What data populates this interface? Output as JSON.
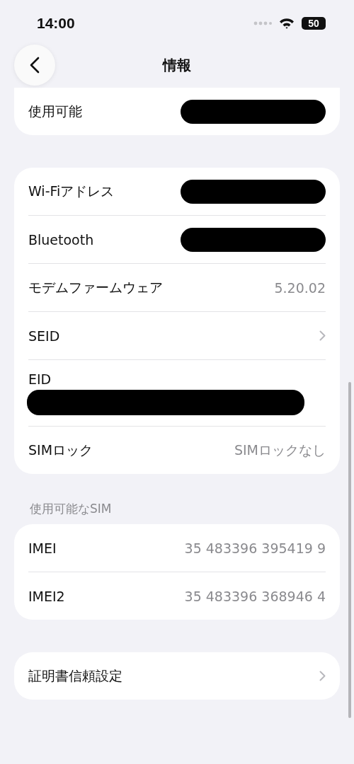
{
  "status_bar": {
    "time": "14:00",
    "battery": "50"
  },
  "nav": {
    "title": "情報"
  },
  "sections": [
    {
      "clipped": true,
      "rows": [
        {
          "label": "使用可能",
          "kind": "redacted"
        }
      ]
    },
    {
      "rows": [
        {
          "label": "Wi-Fiアドレス",
          "kind": "redacted"
        },
        {
          "label": "Bluetooth",
          "kind": "redacted"
        },
        {
          "label": "モデムファームウェア",
          "kind": "text",
          "value": "5.20.02"
        },
        {
          "label": "SEID",
          "kind": "disclosure"
        },
        {
          "label": "EID",
          "kind": "redacted_below"
        },
        {
          "label": "SIMロック",
          "kind": "text",
          "value": "SIMロックなし"
        }
      ]
    },
    {
      "header": "使用可能なSIM",
      "rows": [
        {
          "label": "IMEI",
          "kind": "text",
          "value": "35 483396 395419 9"
        },
        {
          "label": "IMEI2",
          "kind": "text",
          "value": "35 483396 368946 4"
        }
      ]
    },
    {
      "rows": [
        {
          "label": "証明書信頼設定",
          "kind": "disclosure"
        }
      ]
    }
  ]
}
